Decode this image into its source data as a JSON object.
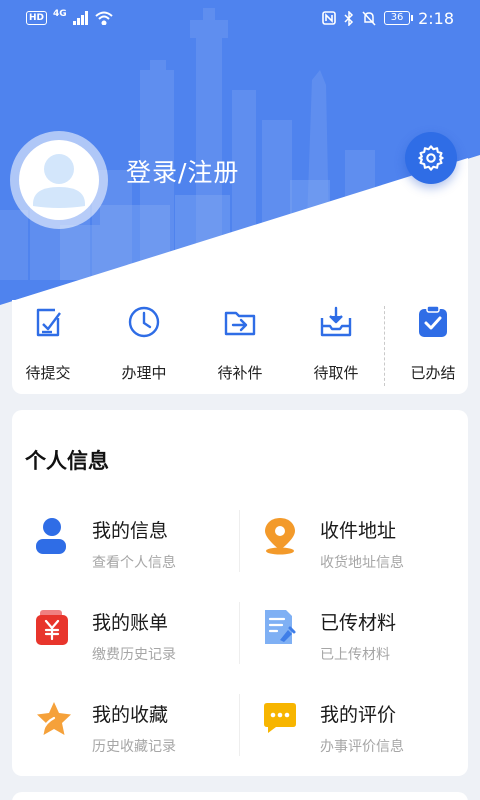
{
  "status_bar": {
    "left_badges": [
      "HD",
      "4G"
    ],
    "battery": "36",
    "time": "2:18",
    "icons": [
      "nfc-icon",
      "bluetooth-icon",
      "mute-icon"
    ]
  },
  "header": {
    "login_label": "登录/注册",
    "settings_icon": "gear-icon",
    "colors": {
      "primary": "#4f83ee",
      "accent": "#2f6de6"
    }
  },
  "status_items": [
    {
      "label": "待提交",
      "icon": "document-edit-icon"
    },
    {
      "label": "办理中",
      "icon": "clock-icon"
    },
    {
      "label": "待补件",
      "icon": "folder-arrow-icon"
    },
    {
      "label": "待取件",
      "icon": "tray-download-icon"
    },
    {
      "label": "已办结",
      "icon": "clipboard-check-icon"
    }
  ],
  "personal_info": {
    "title": "个人信息",
    "items": [
      {
        "title": "我的信息",
        "subtitle": "查看个人信息",
        "icon": "user-icon"
      },
      {
        "title": "收件地址",
        "subtitle": "收货地址信息",
        "icon": "location-pin-icon"
      },
      {
        "title": "我的账单",
        "subtitle": "缴费历史记录",
        "icon": "wallet-yuan-icon"
      },
      {
        "title": "已传材料",
        "subtitle": "已上传材料",
        "icon": "document-upload-icon"
      },
      {
        "title": "我的收藏",
        "subtitle": "历史收藏记录",
        "icon": "star-icon"
      },
      {
        "title": "我的评价",
        "subtitle": "办事评价信息",
        "icon": "chat-bubble-icon"
      }
    ]
  }
}
